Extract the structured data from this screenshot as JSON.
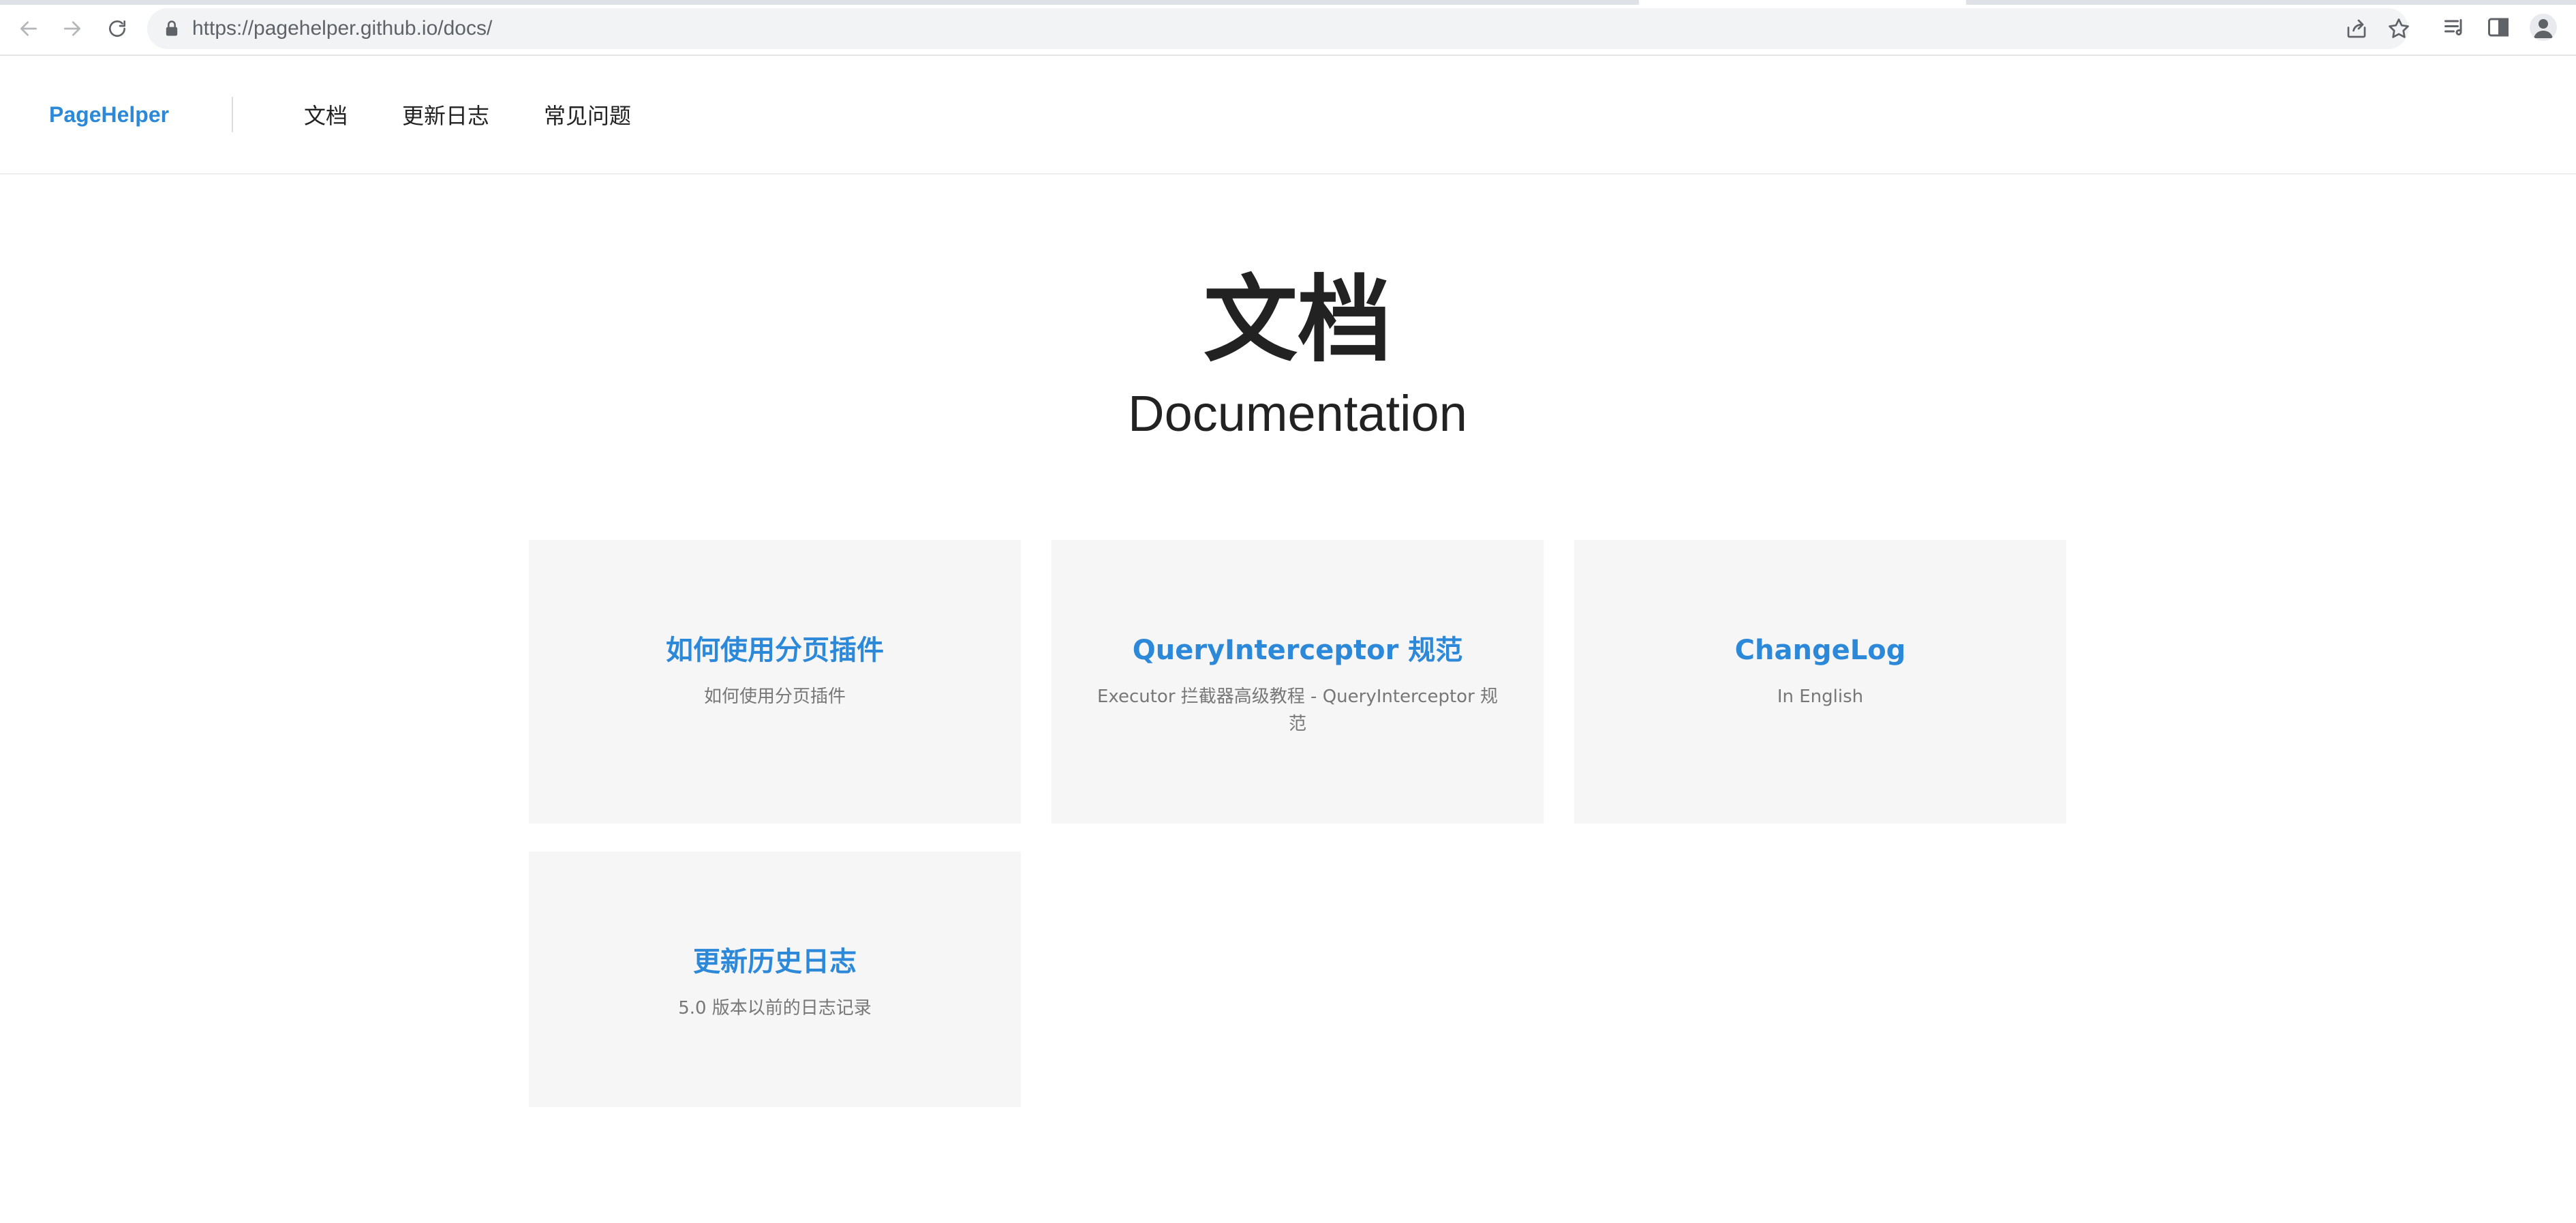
{
  "browser": {
    "url_host": "https://pagehelper.github.io",
    "url_path": "/docs/",
    "icons": {
      "back": "arrow-left-icon",
      "forward": "arrow-right-icon",
      "reload": "reload-icon",
      "lock": "lock-icon",
      "share": "share-icon",
      "bookmark": "star-icon",
      "reading_list": "reading-list-icon",
      "side_panel": "side-panel-icon",
      "profile": "profile-avatar-icon"
    }
  },
  "header": {
    "brand": "PageHelper",
    "nav": [
      "文档",
      "更新日志",
      "常见问题"
    ]
  },
  "hero": {
    "title": "文档",
    "subtitle": "Documentation"
  },
  "cards": [
    {
      "title": "如何使用分页插件",
      "desc": "如何使用分页插件"
    },
    {
      "title": "QueryInterceptor 规范",
      "desc": "Executor 拦截器高级教程 - QueryInterceptor 规范"
    },
    {
      "title": "ChangeLog",
      "desc": "In English"
    },
    {
      "title": "更新历史日志",
      "desc": "5.0 版本以前的日志记录"
    }
  ],
  "colors": {
    "link": "#2c88d9",
    "card_bg": "#f6f6f6",
    "text": "#222222",
    "muted": "#777777"
  }
}
